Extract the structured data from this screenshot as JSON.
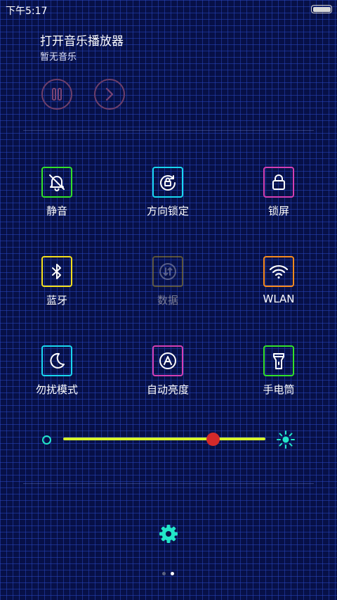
{
  "status_bar": {
    "time": "下午5:17"
  },
  "music": {
    "title": "打开音乐播放器",
    "subtitle": "暂无音乐"
  },
  "toggles": [
    {
      "label": "静音",
      "icon": "mute-bell-icon",
      "color": "#33e12a"
    },
    {
      "label": "方向锁定",
      "icon": "rotation-lock-icon",
      "color": "#19d7f0"
    },
    {
      "label": "锁屏",
      "icon": "padlock-icon",
      "color": "#d43fb3"
    },
    {
      "label": "蓝牙",
      "icon": "bluetooth-icon",
      "color": "#f4df1b"
    },
    {
      "label": "数据",
      "icon": "mobile-data-icon",
      "color": "#a18a2a"
    },
    {
      "label": "WLAN",
      "icon": "wifi-icon",
      "color": "#f78a1d"
    },
    {
      "label": "勿扰模式",
      "icon": "moon-icon",
      "color": "#19d7f0"
    },
    {
      "label": "自动亮度",
      "icon": "auto-brightness-icon",
      "color": "#d43fb3"
    },
    {
      "label": "手电筒",
      "icon": "flashlight-icon",
      "color": "#33e12a"
    }
  ],
  "brightness": {
    "level_percent": 74
  },
  "colors": {
    "background": "#071047",
    "slider_track": "#d7f32a",
    "slider_thumb": "#d42a2a",
    "accent_teal": "#22e6c8"
  },
  "pagination": {
    "current": 2,
    "total": 2
  }
}
